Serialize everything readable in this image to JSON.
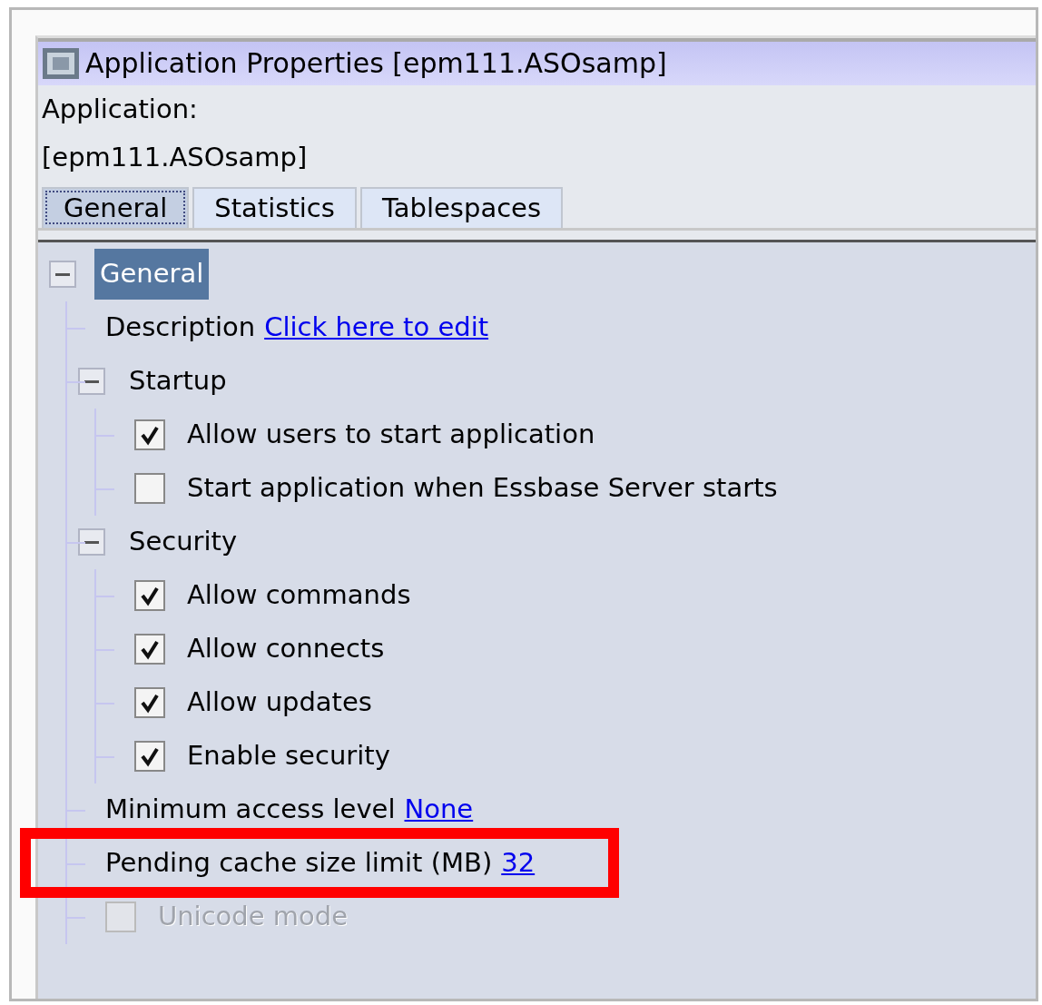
{
  "window": {
    "title": "Application Properties [epm111.ASOsamp]"
  },
  "header": {
    "label": "Application:",
    "value": "[epm111.ASOsamp]"
  },
  "tabs": [
    {
      "label": "General",
      "selected": true
    },
    {
      "label": "Statistics",
      "selected": false
    },
    {
      "label": "Tablespaces",
      "selected": false
    }
  ],
  "tree": {
    "label": "General",
    "kind": "group",
    "expanded": true,
    "selected": true,
    "children": [
      {
        "kind": "property",
        "label": "Description",
        "value": "Click here to edit",
        "highlighted": false
      },
      {
        "kind": "group",
        "label": "Startup",
        "expanded": true,
        "selected": false,
        "children": [
          {
            "kind": "checkbox",
            "label": "Allow users to start application",
            "checked": true,
            "disabled": false
          },
          {
            "kind": "checkbox",
            "label": "Start application when Essbase Server starts",
            "checked": false,
            "disabled": false
          }
        ]
      },
      {
        "kind": "group",
        "label": "Security",
        "expanded": true,
        "selected": false,
        "children": [
          {
            "kind": "checkbox",
            "label": "Allow commands",
            "checked": true,
            "disabled": false
          },
          {
            "kind": "checkbox",
            "label": "Allow connects",
            "checked": true,
            "disabled": false
          },
          {
            "kind": "checkbox",
            "label": "Allow updates",
            "checked": true,
            "disabled": false
          },
          {
            "kind": "checkbox",
            "label": "Enable security",
            "checked": true,
            "disabled": false
          }
        ]
      },
      {
        "kind": "property",
        "label": "Minimum access level",
        "value": "None",
        "highlighted": false
      },
      {
        "kind": "property",
        "label": "Pending cache size limit (MB)",
        "value": "32",
        "highlighted": true
      },
      {
        "kind": "checkbox",
        "label": "Unicode mode",
        "checked": false,
        "disabled": true
      }
    ]
  }
}
